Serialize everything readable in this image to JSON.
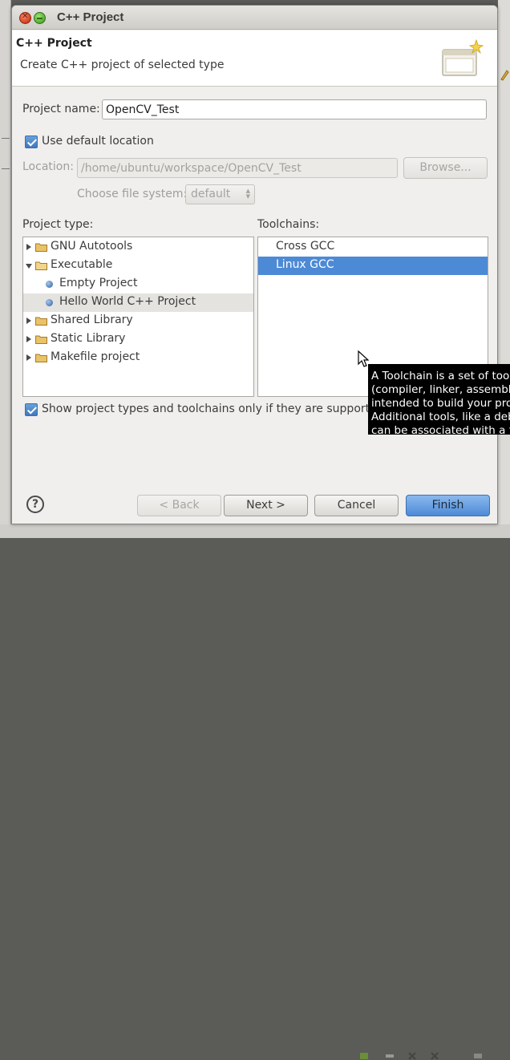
{
  "window": {
    "title": "C++ Project"
  },
  "header": {
    "title": "C++ Project",
    "description": "Create C++ project of selected type"
  },
  "form": {
    "project_name_label": "Project name:",
    "project_name_value": "OpenCV_Test",
    "use_default_location_label": "Use default location",
    "use_default_location_checked": true,
    "location_label": "Location:",
    "location_value": "/home/ubuntu/workspace/OpenCV_Test",
    "browse_label": "Browse...",
    "file_system_label": "Choose file system:",
    "file_system_value": "default"
  },
  "project_type": {
    "label": "Project type:",
    "items": [
      {
        "label": "GNU Autotools",
        "kind": "folder",
        "state": "collapsed"
      },
      {
        "label": "Executable",
        "kind": "folder",
        "state": "expanded"
      },
      {
        "label": "Empty Project",
        "kind": "leaf"
      },
      {
        "label": "Hello World C++ Project",
        "kind": "leaf",
        "selected": true
      },
      {
        "label": "Shared Library",
        "kind": "folder",
        "state": "collapsed"
      },
      {
        "label": "Static Library",
        "kind": "folder",
        "state": "collapsed"
      },
      {
        "label": "Makefile project",
        "kind": "folder",
        "state": "collapsed"
      }
    ]
  },
  "toolchains": {
    "label": "Toolchains:",
    "items": [
      {
        "label": "Cross GCC"
      },
      {
        "label": "Linux GCC",
        "selected": true
      }
    ]
  },
  "show_supported_label": "Show project types and toolchains only if they are supported",
  "show_supported_checked": true,
  "tooltip": {
    "lines": [
      "A Toolchain is a set of tool",
      "(compiler, linker, assemble",
      "intended to build your pro",
      "Additional tools, like a deb",
      "can be associated with a to"
    ]
  },
  "buttons": {
    "back": "< Back",
    "next": "Next >",
    "cancel": "Cancel",
    "finish": "Finish",
    "help": "?"
  },
  "colors": {
    "accent": "#4d8ad6",
    "selection_gray": "#e4e3e0",
    "tooltip_bg": "#000000"
  }
}
